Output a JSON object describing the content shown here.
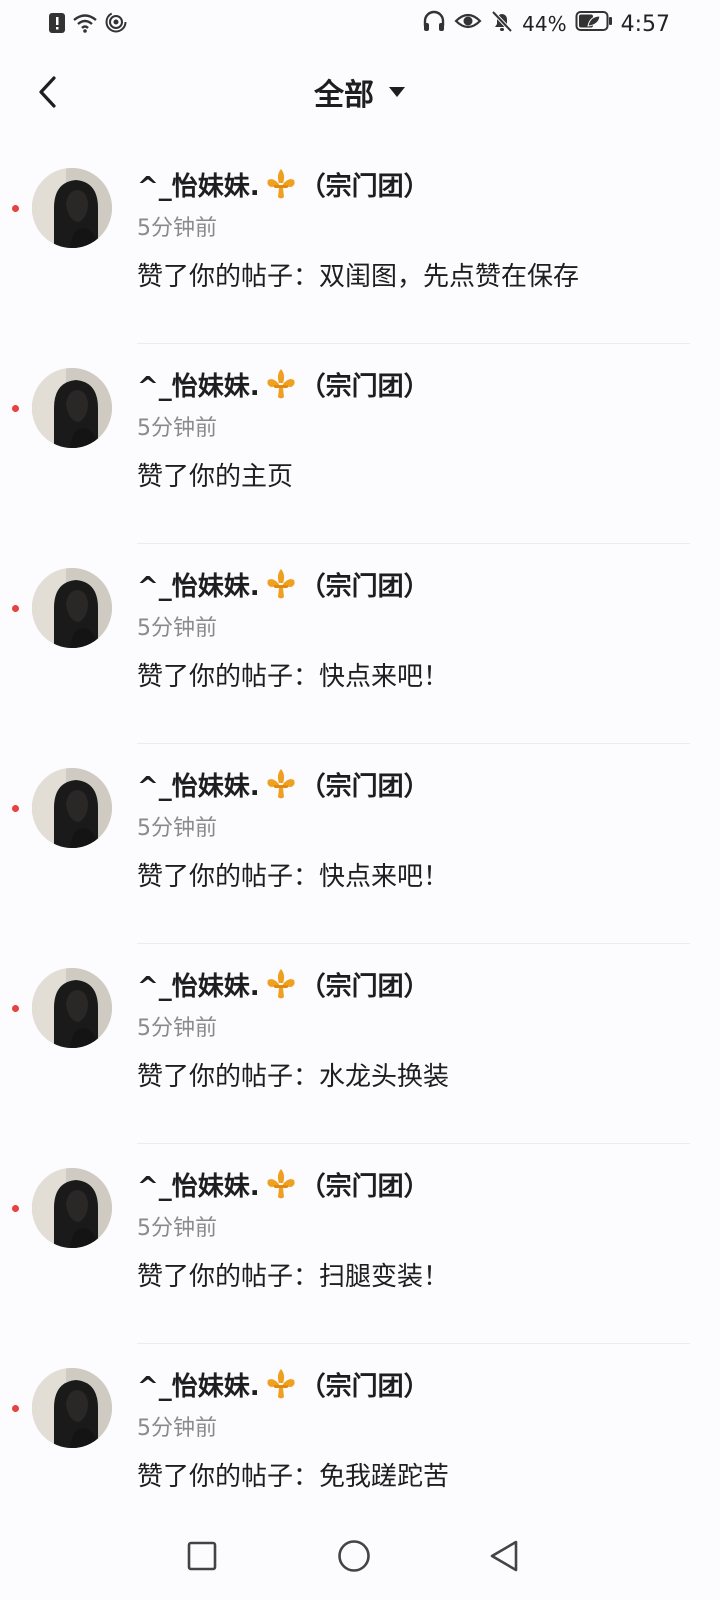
{
  "status_bar": {
    "battery_percent": "44%",
    "time": "4:57",
    "left_icons": [
      "alert-icon",
      "wifi-icon",
      "hotspot-icon"
    ],
    "right_icons": [
      "headphones-icon",
      "eye-icon",
      "bell-off-icon",
      "battery-icon"
    ]
  },
  "header": {
    "title": "全部",
    "back_icon": "chevron-left-icon",
    "dropdown_icon": "triangle-down-icon"
  },
  "colors": {
    "unread_dot": "#e8423f",
    "secondary_text": "#8a8a8a",
    "badge": "#f0a020"
  },
  "notifications": [
    {
      "name": "^_怡妹妹.",
      "badge": "fleur-de-lis-icon",
      "team": "（宗门团）",
      "time": "5分钟前",
      "action": "赞了你的帖子：双闺图，先点赞在保存",
      "unread": true
    },
    {
      "name": "^_怡妹妹.",
      "badge": "fleur-de-lis-icon",
      "team": "（宗门团）",
      "time": "5分钟前",
      "action": "赞了你的主页",
      "unread": true
    },
    {
      "name": "^_怡妹妹.",
      "badge": "fleur-de-lis-icon",
      "team": "（宗门团）",
      "time": "5分钟前",
      "action": "赞了你的帖子：快点来吧！",
      "unread": true
    },
    {
      "name": "^_怡妹妹.",
      "badge": "fleur-de-lis-icon",
      "team": "（宗门团）",
      "time": "5分钟前",
      "action": "赞了你的帖子：快点来吧！",
      "unread": true
    },
    {
      "name": "^_怡妹妹.",
      "badge": "fleur-de-lis-icon",
      "team": "（宗门团）",
      "time": "5分钟前",
      "action": "赞了你的帖子：水龙头换装",
      "unread": true
    },
    {
      "name": "^_怡妹妹.",
      "badge": "fleur-de-lis-icon",
      "team": "（宗门团）",
      "time": "5分钟前",
      "action": "赞了你的帖子：扫腿变装！",
      "unread": true
    },
    {
      "name": "^_怡妹妹.",
      "badge": "fleur-de-lis-icon",
      "team": "（宗门团）",
      "time": "5分钟前",
      "action": "赞了你的帖子：免我蹉跎苦",
      "unread": true
    }
  ],
  "nav_bar": {
    "items": [
      "recents-square-icon",
      "home-circle-icon",
      "back-triangle-icon"
    ]
  }
}
